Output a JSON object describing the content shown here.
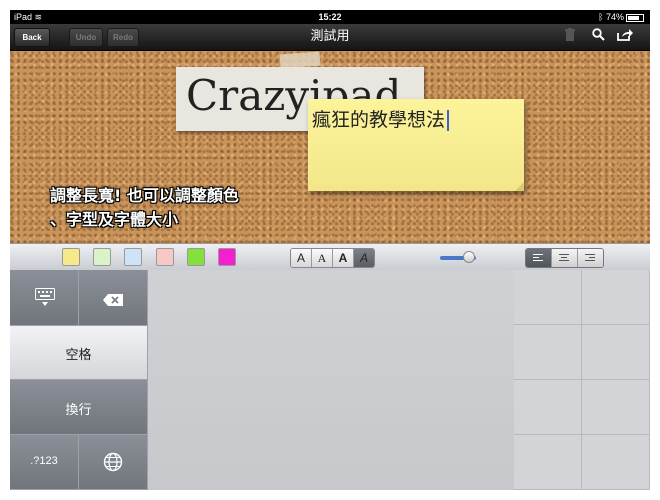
{
  "status_bar": {
    "device": "iPad",
    "time": "15:22",
    "battery": "74%"
  },
  "nav": {
    "back_label": "Back",
    "undo_label": "Undo",
    "redo_label": "Redo",
    "title": "測試用",
    "icons": [
      "trash-icon",
      "search-icon",
      "share-icon"
    ]
  },
  "board": {
    "paper_text": "Crazyipad",
    "note_text": "瘋狂的教學想法",
    "caption_line1": "調整長寬! 也可以調整顏色",
    "caption_line2": "、字型及字體大小"
  },
  "toolbar": {
    "swatch_colors": [
      "#f7e98a",
      "#d8f3c8",
      "#cfe3f7",
      "#f6c9c6",
      "#86e03c",
      "#f41fcf"
    ],
    "font_buttons": [
      "A",
      "A",
      "A",
      "A"
    ],
    "alignments": [
      "align-left",
      "align-center",
      "align-right"
    ],
    "selected_alignment": "align-left",
    "size_slider_level": 0.8
  },
  "keyboard": {
    "keyboard_icon": "keyboard-hide-icon",
    "delete_icon": "delete-icon",
    "space_label": "空格",
    "return_label": "換行",
    "numbers_label": ".?123",
    "globe_icon": "globe-icon"
  }
}
